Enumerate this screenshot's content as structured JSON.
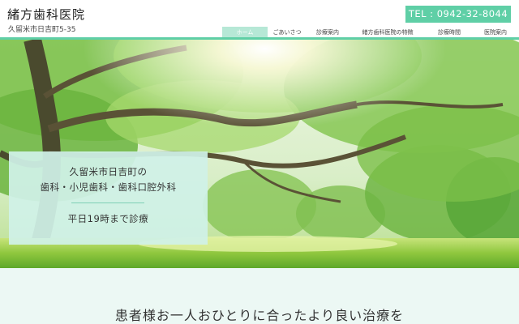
{
  "header": {
    "clinic_name": "緒方歯科医院",
    "address": "久留米市日吉町5-35",
    "tel": "TEL : 0942-32-8044"
  },
  "nav": {
    "items": [
      "ホーム",
      "ごあいさつ",
      "診療案内",
      "緒方歯科医院の特徴",
      "診療時間",
      "医院案内"
    ],
    "active": "ホーム"
  },
  "hero": {
    "line1": "久留米市日吉町の",
    "line2": "歯科・小児歯科・歯科口腔外科",
    "hours": "平日19時まで診療"
  },
  "tagline": "患者様お一人おひとりに合ったより良い治療を",
  "colors": {
    "accent": "#5fcfa6",
    "nav_active": "#b6e8d6",
    "info_box": "#d0f1e7",
    "bottom_bg": "#ecf8f4"
  }
}
